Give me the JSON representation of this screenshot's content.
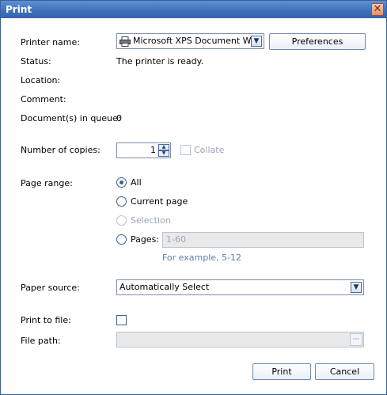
{
  "window": {
    "title": "Print",
    "close_glyph": "✕"
  },
  "printer": {
    "name_label": "Printer name:",
    "selected": "Microsoft XPS Document Wr...",
    "preferences_label": "Preferences",
    "status_label": "Status:",
    "status_value": "The printer is ready.",
    "location_label": "Location:",
    "comment_label": "Comment:",
    "queue_label": "Document(s) in queue:",
    "queue_value": "0"
  },
  "copies": {
    "label": "Number of copies:",
    "value": "1",
    "collate_label": "Collate"
  },
  "page_range": {
    "label": "Page range:",
    "options": [
      "All",
      "Current page",
      "Selection",
      "Pages:"
    ],
    "selected": "All",
    "pages_value": "1-60",
    "example": "For example, 5-12"
  },
  "paper_source": {
    "label": "Paper source:",
    "selected": "Automatically Select"
  },
  "print_to_file": {
    "label": "Print to file:",
    "file_path_label": "File path:",
    "browse_label": "···"
  },
  "actions": {
    "print_label": "Print",
    "cancel_label": "Cancel"
  },
  "icons": {
    "printer": "printer-icon",
    "dropdown": "chevron-down-icon"
  }
}
